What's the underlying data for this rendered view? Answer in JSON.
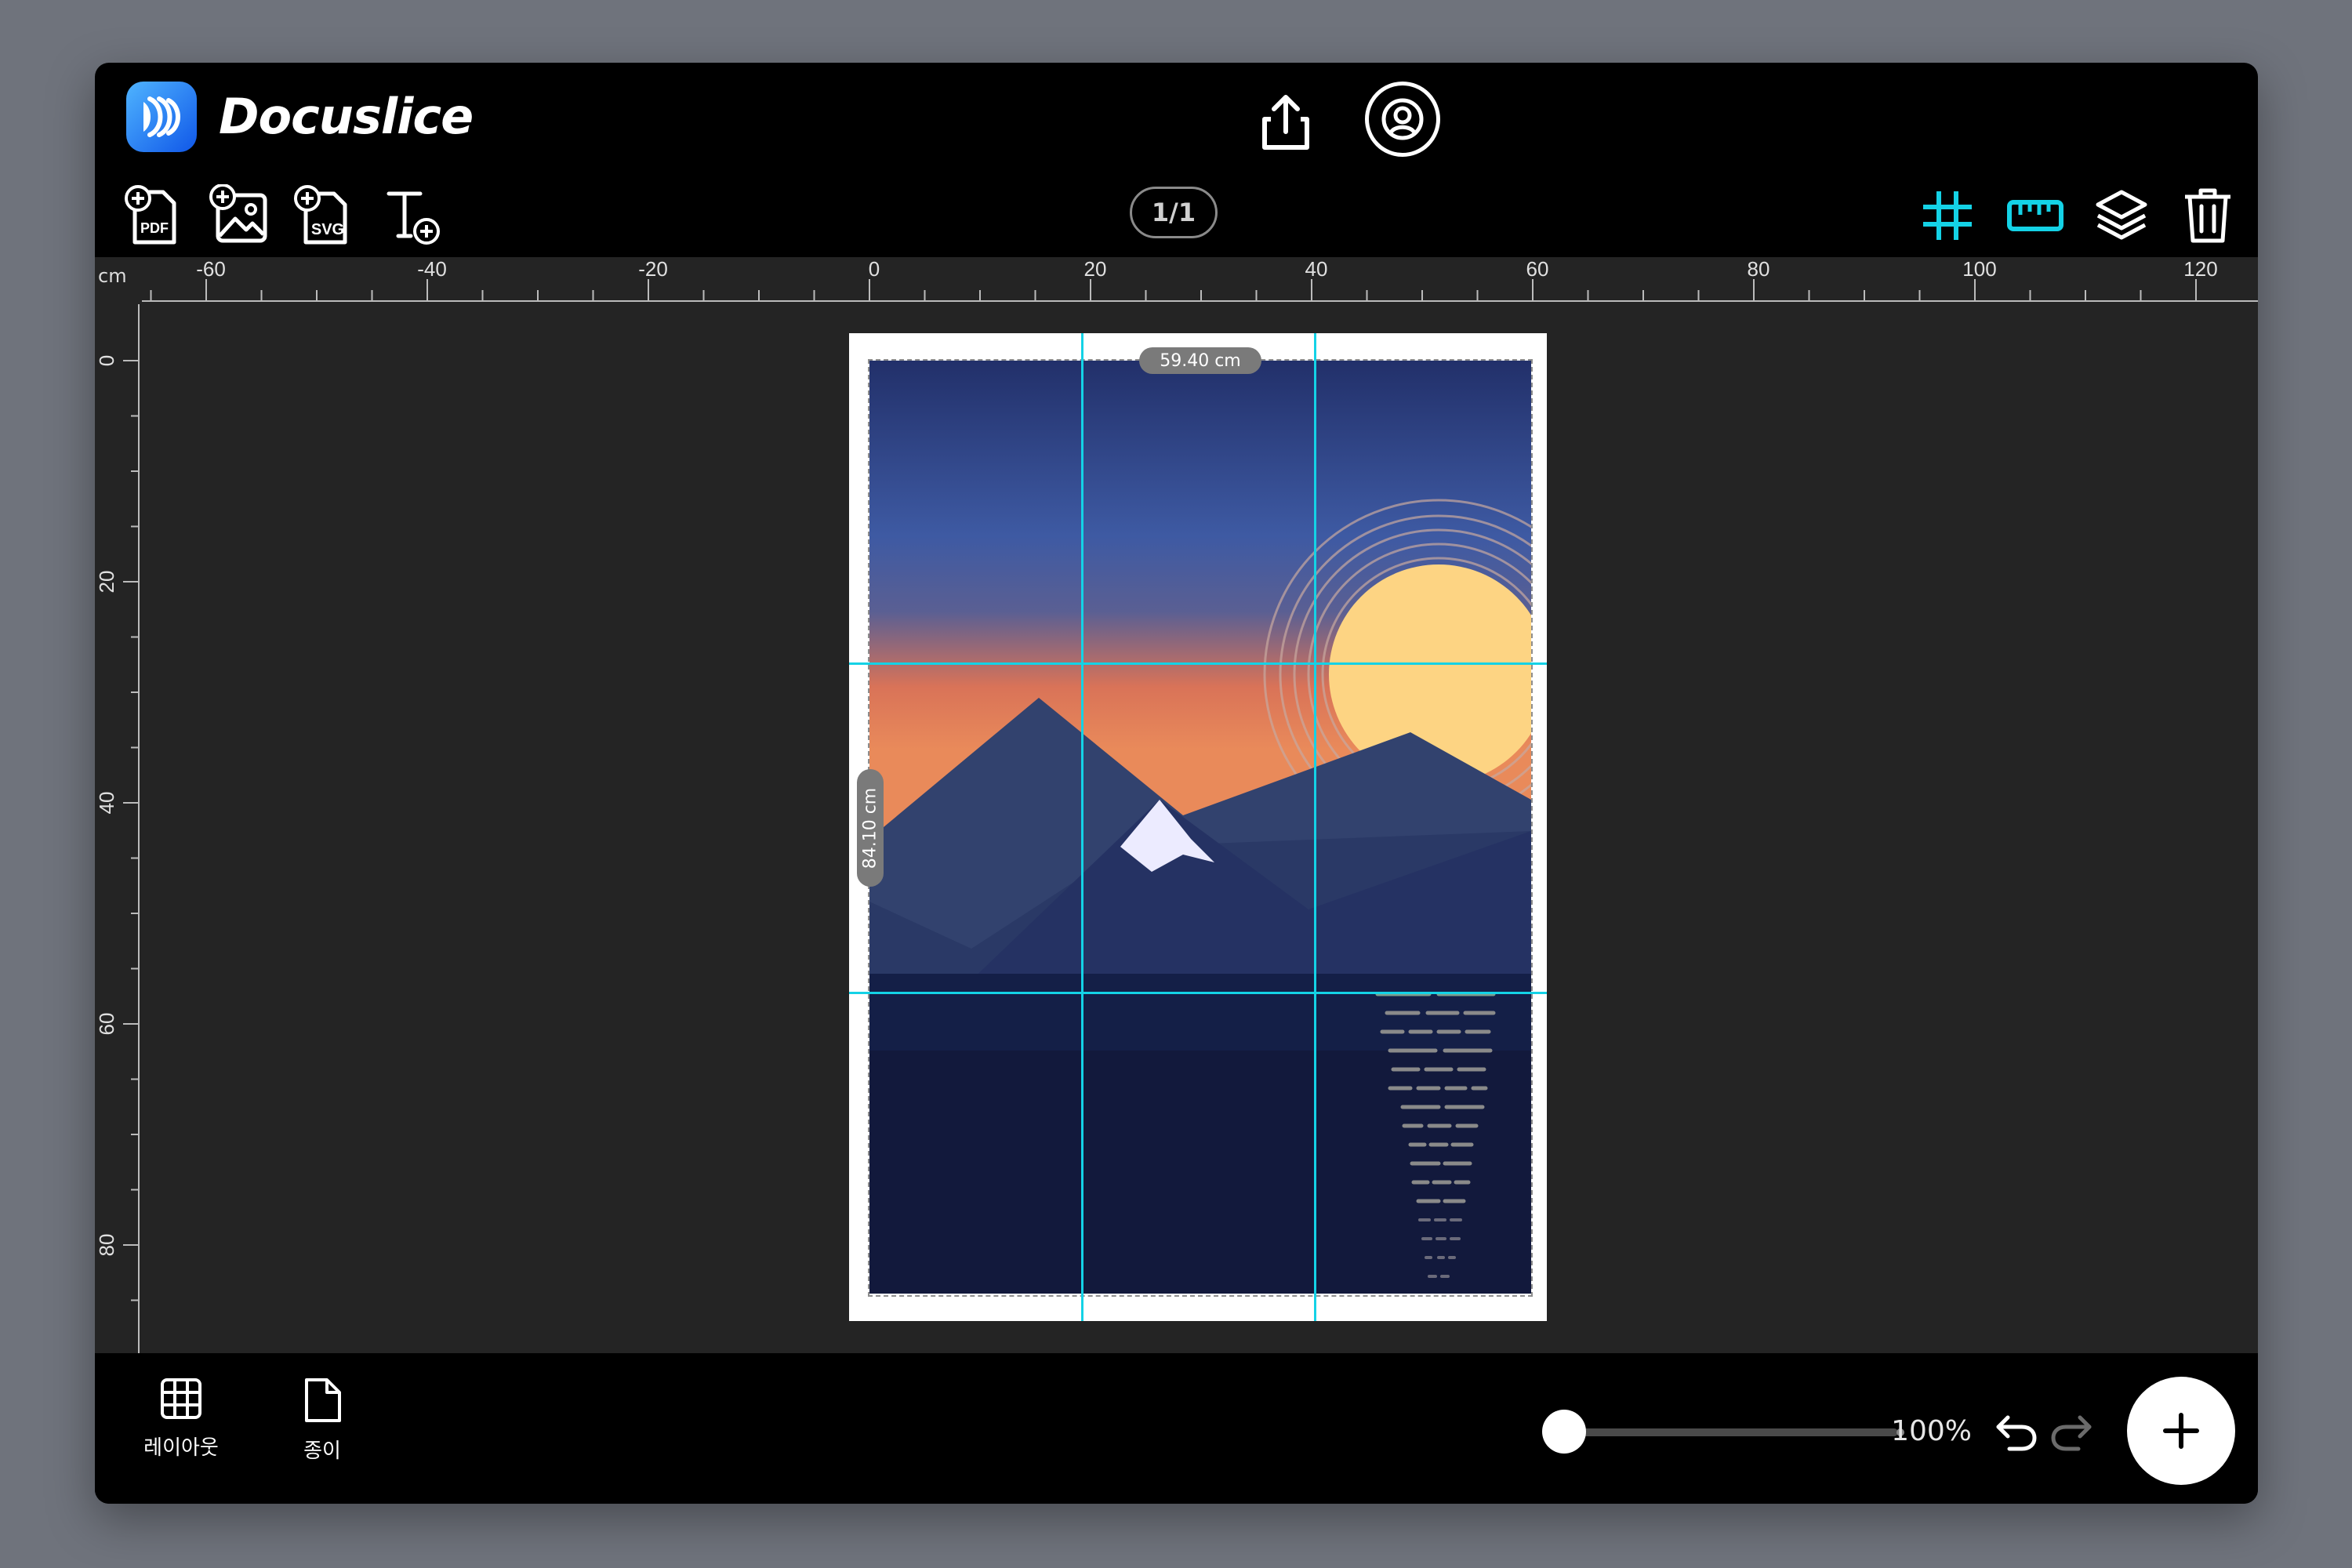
{
  "app": {
    "title": "Docuslice",
    "icons": {
      "logo": "docuslice-logo-icon",
      "share": "share-upload-icon",
      "account": "account-icon"
    }
  },
  "toolbar": {
    "tools": [
      {
        "name": "add-pdf-icon",
        "badge": "PDF"
      },
      {
        "name": "add-image-icon"
      },
      {
        "name": "add-svg-icon",
        "badge": "SVG"
      },
      {
        "name": "add-text-icon"
      }
    ],
    "page_indicator": "1/1",
    "right_tools": [
      {
        "name": "grid-icon",
        "active": true
      },
      {
        "name": "ruler-icon",
        "active": true
      },
      {
        "name": "layers-icon",
        "active": false
      },
      {
        "name": "trash-icon",
        "active": false
      }
    ]
  },
  "rulers": {
    "unit": "cm",
    "horizontal_ticks": [
      "-60",
      "-40",
      "-20",
      "0",
      "20",
      "40",
      "60",
      "80",
      "100",
      "120"
    ],
    "vertical_ticks": [
      "0",
      "20",
      "40",
      "60",
      "80"
    ]
  },
  "paper": {
    "width_label": "59.40 cm",
    "height_label": "84.10 cm"
  },
  "bottom_bar": {
    "tabs": [
      {
        "label": "레이아웃",
        "icon": "layout-grid-icon"
      },
      {
        "label": "종이",
        "icon": "paper-icon"
      }
    ],
    "zoom": {
      "value_text": "100%",
      "level": 0.0
    },
    "undo": "undo-icon",
    "redo": "redo-icon",
    "add": "plus-icon"
  },
  "colors": {
    "accent": "#14d2e6",
    "background": "#000000",
    "canvas": "#242424"
  }
}
